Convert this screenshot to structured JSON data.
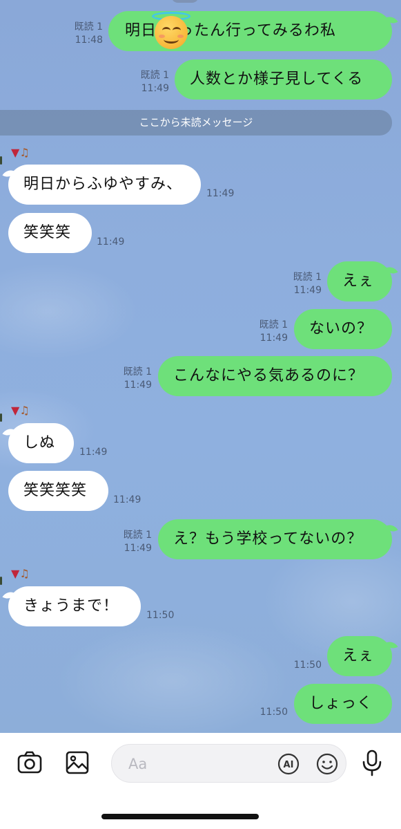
{
  "chat": {
    "divider_text": "ここから未読メッセージ",
    "messages": [
      {
        "text": "明日 いったん行ってみるわ私",
        "emoji": "smiling-face-with-halo",
        "direction": "sent",
        "read": "既読 1",
        "time": "11:48"
      },
      {
        "text": "人数とか様子見してくる",
        "direction": "sent",
        "read": "既読 1",
        "time": "11:49"
      },
      {
        "text": "明日からふゆやすみ、",
        "direction": "received",
        "time": "11:49"
      },
      {
        "text": "笑笑笑",
        "direction": "received",
        "time": "11:49"
      },
      {
        "text": "えぇ",
        "direction": "sent",
        "read": "既読 1",
        "time": "11:49"
      },
      {
        "text": "ないの？",
        "direction": "sent",
        "read": "既読 1",
        "time": "11:49"
      },
      {
        "text": "こんなにやる気あるのに？",
        "direction": "sent",
        "read": "既読 1",
        "time": "11:49"
      },
      {
        "text": "しぬ",
        "direction": "received",
        "time": "11:49"
      },
      {
        "text": "笑笑笑笑",
        "direction": "received",
        "time": "11:49"
      },
      {
        "text": "え？もう学校ってないの？",
        "direction": "sent",
        "read": "既読 1",
        "time": "11:49"
      },
      {
        "text": "きょうまで！",
        "direction": "received",
        "time": "11:50"
      },
      {
        "text": "えぇ",
        "direction": "sent",
        "time": "11:50"
      },
      {
        "text": "しょっく",
        "direction": "sent",
        "time": "11:50"
      }
    ],
    "sender_icons": [
      "folding-fan-icon",
      "violin-icon"
    ]
  },
  "input_bar": {
    "placeholder": "Aa",
    "ai_label": "AI",
    "icons": [
      "camera-icon",
      "image-icon",
      "ai-icon",
      "emoji-icon",
      "microphone-icon"
    ]
  },
  "colors": {
    "sent_bubble": "#6ee07a",
    "received_bubble": "#ffffff",
    "chat_background": "#8eaedd",
    "divider": "#738caf"
  }
}
